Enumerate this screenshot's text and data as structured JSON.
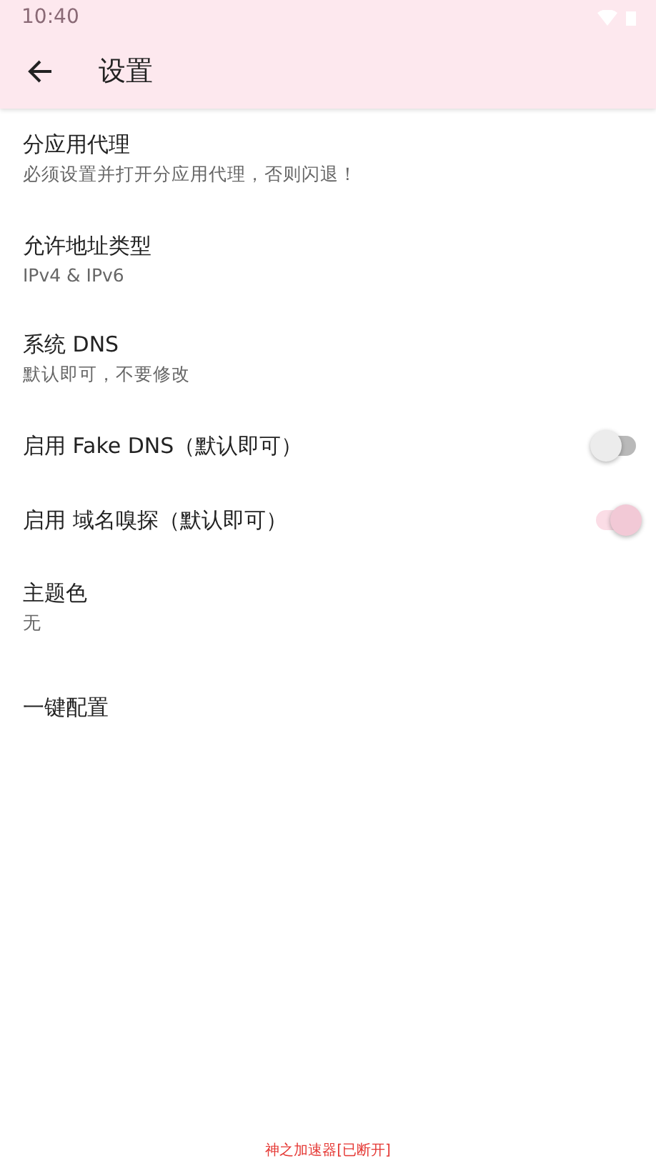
{
  "status_bar": {
    "time": "10:40"
  },
  "app_bar": {
    "title": "设置"
  },
  "settings": [
    {
      "kind": "text",
      "title": "分应用代理",
      "summary": "必须设置并打开分应用代理，否则闪退！"
    },
    {
      "kind": "text",
      "title": "允许地址类型",
      "summary": "IPv4 & IPv6"
    },
    {
      "kind": "text",
      "title": "系统 DNS",
      "summary": "默认即可，不要修改"
    },
    {
      "kind": "switch",
      "title": "启用 Fake DNS（默认即可）",
      "on": false
    },
    {
      "kind": "switch",
      "title": "启用 域名嗅探（默认即可）",
      "on": true
    },
    {
      "kind": "text",
      "title": "主题色",
      "summary": "无"
    },
    {
      "kind": "text",
      "title": "一键配置"
    }
  ],
  "footer": "神之加速器[已断开]"
}
